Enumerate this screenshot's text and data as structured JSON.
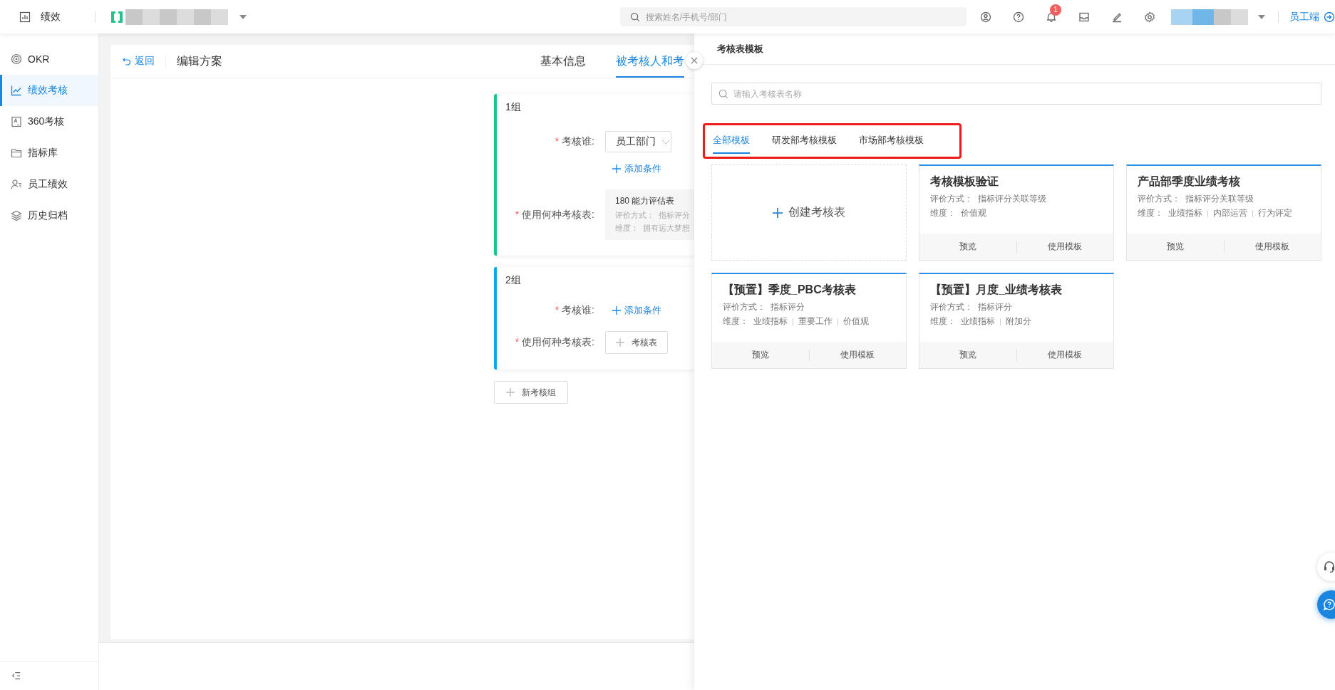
{
  "topbar": {
    "module": "绩效",
    "search": {
      "placeholder": "搜索姓名/手机号/部门"
    },
    "notification_count": "1",
    "switch_link": "员工端"
  },
  "sidebar": {
    "items": [
      {
        "label": "OKR",
        "selected": false
      },
      {
        "label": "绩效考核",
        "selected": true
      },
      {
        "label": "360考核",
        "selected": false
      },
      {
        "label": "指标库",
        "selected": false
      },
      {
        "label": "员工绩效",
        "selected": false
      },
      {
        "label": "历史归档",
        "selected": false
      }
    ]
  },
  "page": {
    "back": "返回",
    "title": "编辑方案",
    "tabs": [
      {
        "label": "基本信息",
        "selected": false
      },
      {
        "label": "被考核人和考",
        "selected": true
      }
    ]
  },
  "groups": [
    {
      "title": "1组",
      "color": "#19c48a",
      "who": {
        "mark": "*",
        "label": "考核谁:",
        "select": "员工部门"
      },
      "add_condition": "添加条件",
      "sheet": {
        "mark": "*",
        "label": "使用何种考核表:",
        "name": "180 能力评估表",
        "method_label": "评价方式：",
        "method": "指标评分",
        "dims_label": "维度：",
        "dims": "拥有远大梦想"
      }
    },
    {
      "title": "2组",
      "color": "#0ea5ec",
      "who": {
        "mark": "*",
        "label": "考核谁:"
      },
      "add_condition": "添加条件",
      "sheet": {
        "mark": "*",
        "label": "使用何种考核表:",
        "button": "考核表"
      }
    }
  ],
  "new_group": "新考核组",
  "drawer": {
    "title": "考核表模板",
    "search": {
      "placeholder": "请输入考核表名称"
    },
    "tabs": [
      {
        "label": "全部模板",
        "selected": true
      },
      {
        "label": "研发部考核模板",
        "selected": false
      },
      {
        "label": "市场部考核模板",
        "selected": false
      }
    ],
    "create": "创建考核表",
    "templates": [
      {
        "name": "考核模板验证",
        "method_label": "评价方式：",
        "method": "指标评分关联等级",
        "dims_label": "维度：",
        "dims": [
          "价值观"
        ],
        "actions": [
          "预览",
          "使用模板"
        ]
      },
      {
        "name": "产品部季度业绩考核",
        "method_label": "评价方式：",
        "method": "指标评分关联等级",
        "dims_label": "维度：",
        "dims": [
          "业绩指标",
          "内部运营",
          "行为评定"
        ],
        "actions": [
          "预览",
          "使用模板"
        ]
      },
      {
        "name": "【预置】季度_PBC考核表",
        "method_label": "评价方式：",
        "method": "指标评分",
        "dims_label": "维度：",
        "dims": [
          "业绩指标",
          "重要工作",
          "价值观"
        ],
        "actions": [
          "预览",
          "使用模板"
        ]
      },
      {
        "name": "【预置】月度_业绩考核表",
        "method_label": "评价方式：",
        "method": "指标评分",
        "dims_label": "维度：",
        "dims": [
          "业绩指标",
          "附加分"
        ],
        "actions": [
          "预览",
          "使用模板"
        ]
      }
    ]
  }
}
